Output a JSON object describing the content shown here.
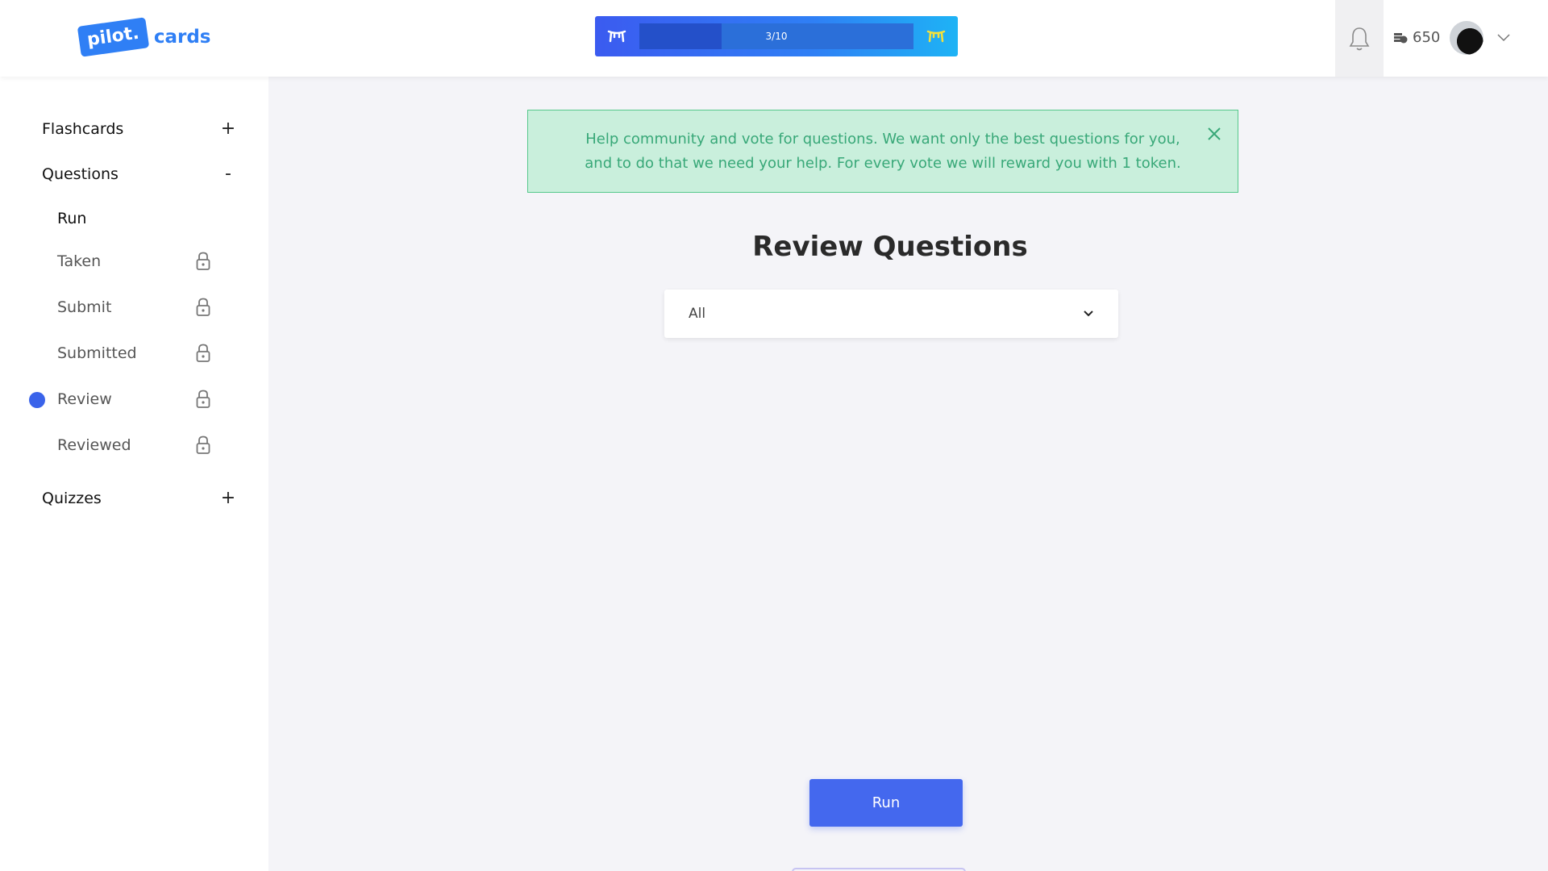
{
  "header": {
    "logo_badge": "pilot.",
    "logo_text": "cards",
    "progress": {
      "label": "3/10",
      "fraction": 0.3
    },
    "tokens": "650"
  },
  "sidebar": {
    "sections": [
      {
        "label": "Flashcards",
        "toggle": "+"
      },
      {
        "label": "Questions",
        "toggle": "-"
      },
      {
        "label": "Quizzes",
        "toggle": "+"
      }
    ],
    "items": [
      {
        "label": "Run",
        "locked": false
      },
      {
        "label": "Taken",
        "locked": true
      },
      {
        "label": "Submit",
        "locked": true
      },
      {
        "label": "Submitted",
        "locked": true
      },
      {
        "label": "Review",
        "locked": true,
        "active": true
      },
      {
        "label": "Reviewed",
        "locked": true
      }
    ]
  },
  "alert": {
    "text": "Help community and vote for questions. We want only the best questions for you, and to do that we need your help. For every vote we will reward you with 1 token."
  },
  "main": {
    "title": "Review Questions",
    "filter": {
      "value": "All"
    },
    "run_label": "Run"
  },
  "colors": {
    "accent": "#4468ee",
    "alert_bg": "#c9efdc",
    "alert_text": "#38a878"
  }
}
